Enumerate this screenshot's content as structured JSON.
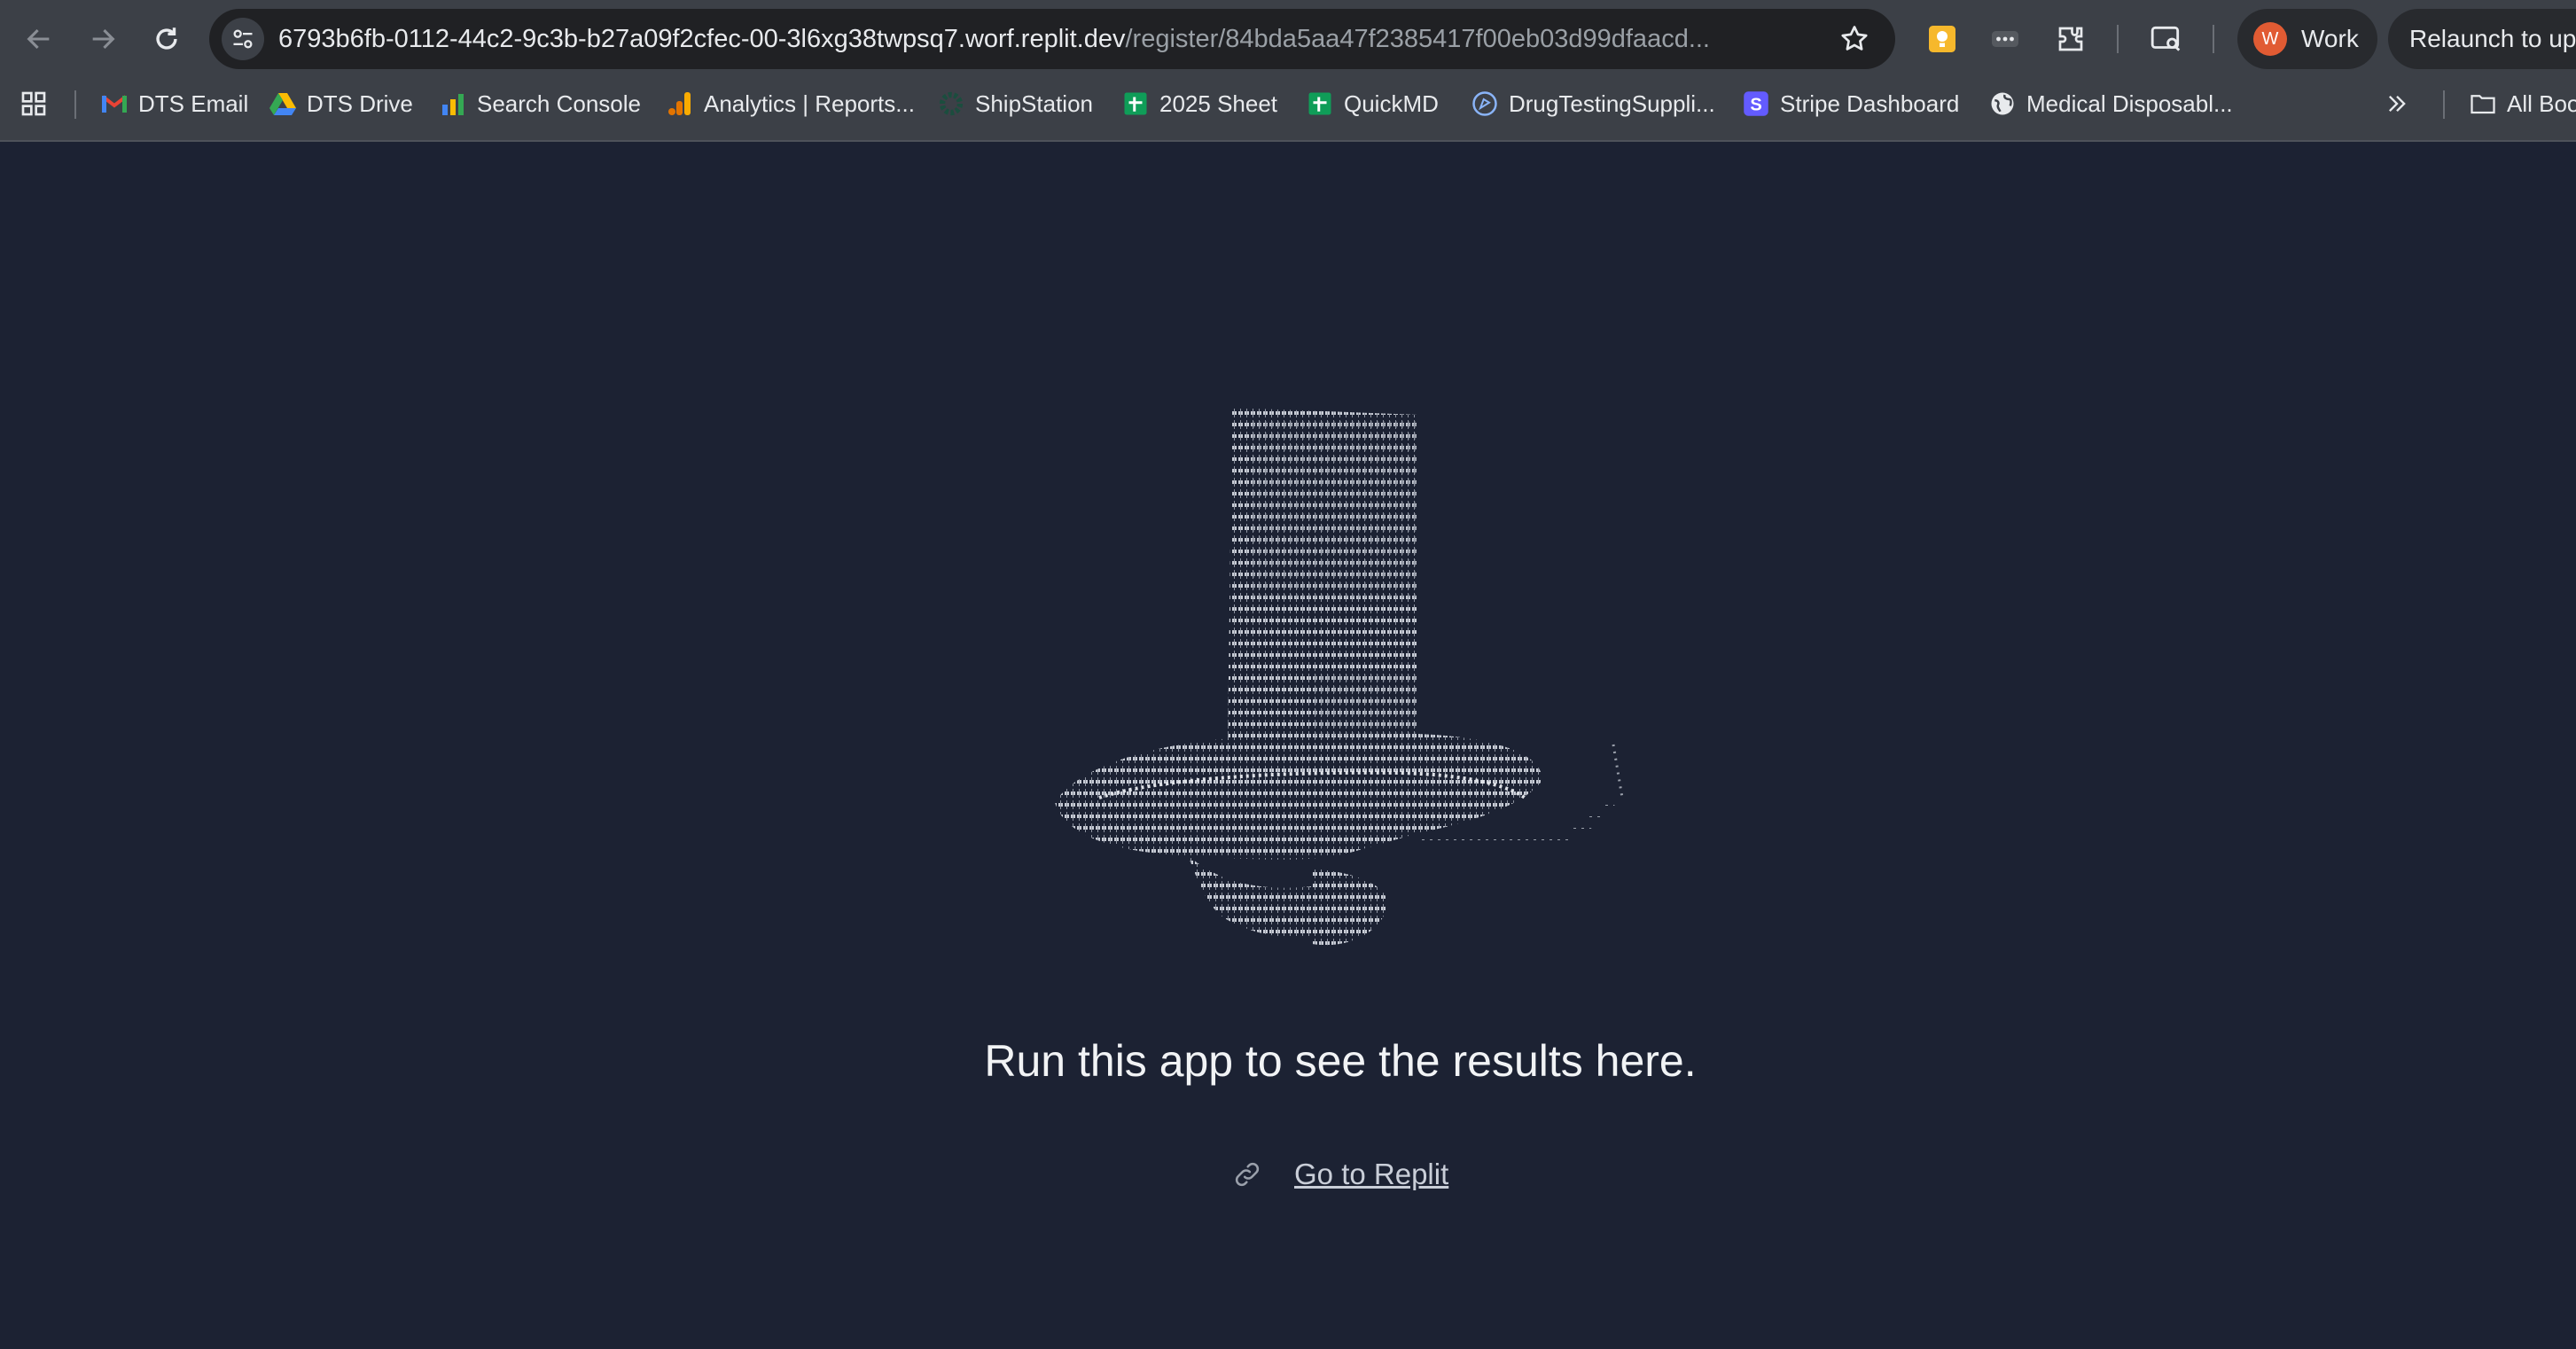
{
  "browser": {
    "url_host": "6793b6fb-0112-44c2-9c3b-b27a09f2cfec-00-3l6xg38twpsq7.worf.replit.dev",
    "url_path": "/register/84bda5aa47f2385417f00eb03d99dfaacd...",
    "profile_initial": "W",
    "profile_name": "Work",
    "relaunch_label": "Relaunch to upd"
  },
  "bookmarks": [
    {
      "label": "DTS Email",
      "icon": "gmail-icon"
    },
    {
      "label": "DTS Drive",
      "icon": "google-drive-icon"
    },
    {
      "label": "Search Console",
      "icon": "search-console-icon"
    },
    {
      "label": "Analytics | Reports...",
      "icon": "analytics-icon"
    },
    {
      "label": "ShipStation",
      "icon": "gear-icon"
    },
    {
      "label": "2025 Sheet",
      "icon": "sheets-icon"
    },
    {
      "label": "QuickMD",
      "icon": "sheets-icon"
    },
    {
      "label": "DrugTestingSuppli...",
      "icon": "globe-icon"
    },
    {
      "label": "Stripe Dashboard",
      "icon": "stripe-icon"
    },
    {
      "label": "Medical Disposabl...",
      "icon": "globe-icon"
    }
  ],
  "all_bookmarks_label": "All Boo",
  "page": {
    "message": "Run this app to see the results here.",
    "link_label": "Go to Replit"
  },
  "colors": {
    "page_background": "#1c2233",
    "chrome_background": "#3c4047",
    "omnibox_background": "#202124",
    "avatar": "#e15b33"
  }
}
